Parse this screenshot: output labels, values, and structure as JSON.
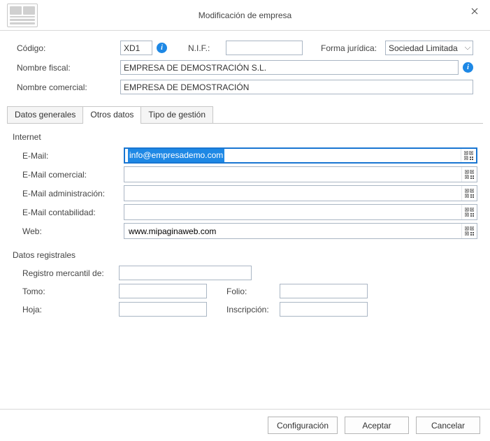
{
  "window": {
    "title": "Modificación de empresa"
  },
  "header": {
    "codigo_label": "Código:",
    "codigo_value": "XD1",
    "nif_label": "N.I.F.:",
    "nif_value": "",
    "forma_label": "Forma jurídica:",
    "forma_value": "Sociedad Limitada",
    "nombre_fiscal_label": "Nombre fiscal:",
    "nombre_fiscal_value": "EMPRESA DE DEMOSTRACIÓN S.L.",
    "nombre_comercial_label": "Nombre comercial:",
    "nombre_comercial_value": "EMPRESA DE DEMOSTRACIÓN"
  },
  "tabs": {
    "t0": "Datos generales",
    "t1": "Otros datos",
    "t2": "Tipo de gestión",
    "active": 1
  },
  "internet": {
    "title": "Internet",
    "email_label": "E-Mail:",
    "email_value": "info@empresademo.com",
    "email_comercial_label": "E-Mail comercial:",
    "email_comercial_value": "",
    "email_admin_label": "E-Mail administración:",
    "email_admin_value": "",
    "email_conta_label": "E-Mail contabilidad:",
    "email_conta_value": "",
    "web_label": "Web:",
    "web_value": "www.mipaginaweb.com"
  },
  "registrales": {
    "title": "Datos registrales",
    "registro_label": "Registro mercantil de:",
    "registro_value": "",
    "tomo_label": "Tomo:",
    "tomo_value": "",
    "folio_label": "Folio:",
    "folio_value": "",
    "hoja_label": "Hoja:",
    "hoja_value": "",
    "inscripcion_label": "Inscripción:",
    "inscripcion_value": ""
  },
  "footer": {
    "config": "Configuración",
    "ok": "Aceptar",
    "cancel": "Cancelar"
  }
}
